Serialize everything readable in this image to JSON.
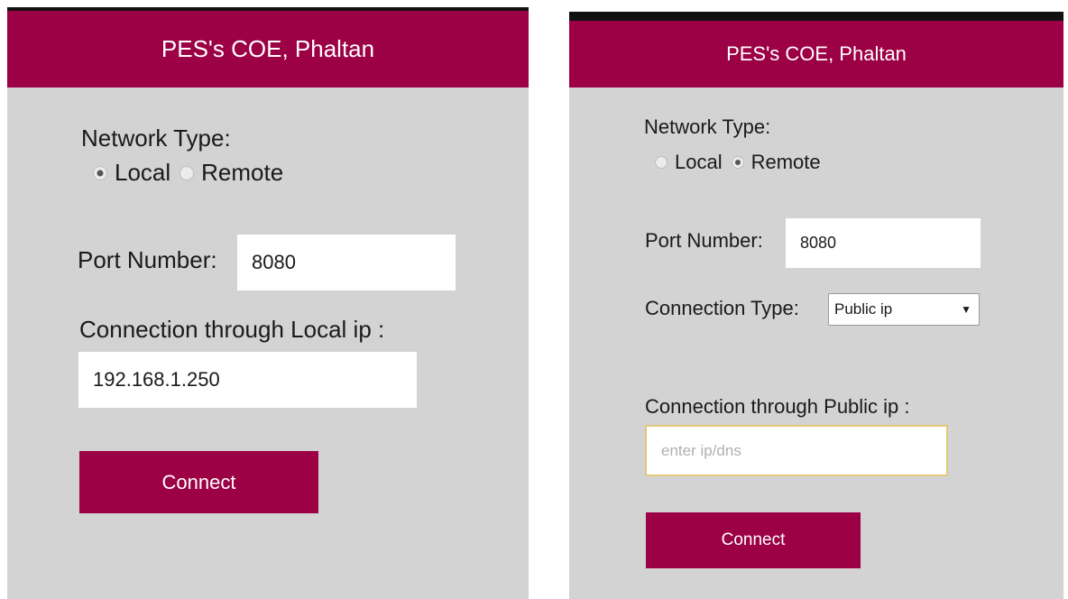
{
  "left": {
    "header": {
      "title": "PES's COE, Phaltan"
    },
    "network": {
      "label": "Network Type:",
      "options": [
        {
          "label": "Local",
          "checked": true
        },
        {
          "label": "Remote",
          "checked": false
        }
      ]
    },
    "port": {
      "label": "Port Number:",
      "value": "8080"
    },
    "connection": {
      "label": "Connection through Local ip :",
      "value": "192.168.1.250"
    },
    "button": {
      "label": "Connect"
    }
  },
  "right": {
    "header": {
      "title": "PES's COE, Phaltan"
    },
    "network": {
      "label": "Network Type:",
      "options": [
        {
          "label": "Local",
          "checked": false
        },
        {
          "label": "Remote",
          "checked": true
        }
      ]
    },
    "port": {
      "label": "Port Number:",
      "value": "8080"
    },
    "connection_type": {
      "label": "Connection Type:",
      "selected": "Public ip"
    },
    "connection": {
      "label": "Connection through Public ip :",
      "placeholder": "enter ip/dns"
    },
    "button": {
      "label": "Connect"
    }
  },
  "colors": {
    "header": "#9c0045",
    "panel": "#d3d3d3",
    "button": "#9c0045",
    "focus_border": "#e2c87b"
  }
}
